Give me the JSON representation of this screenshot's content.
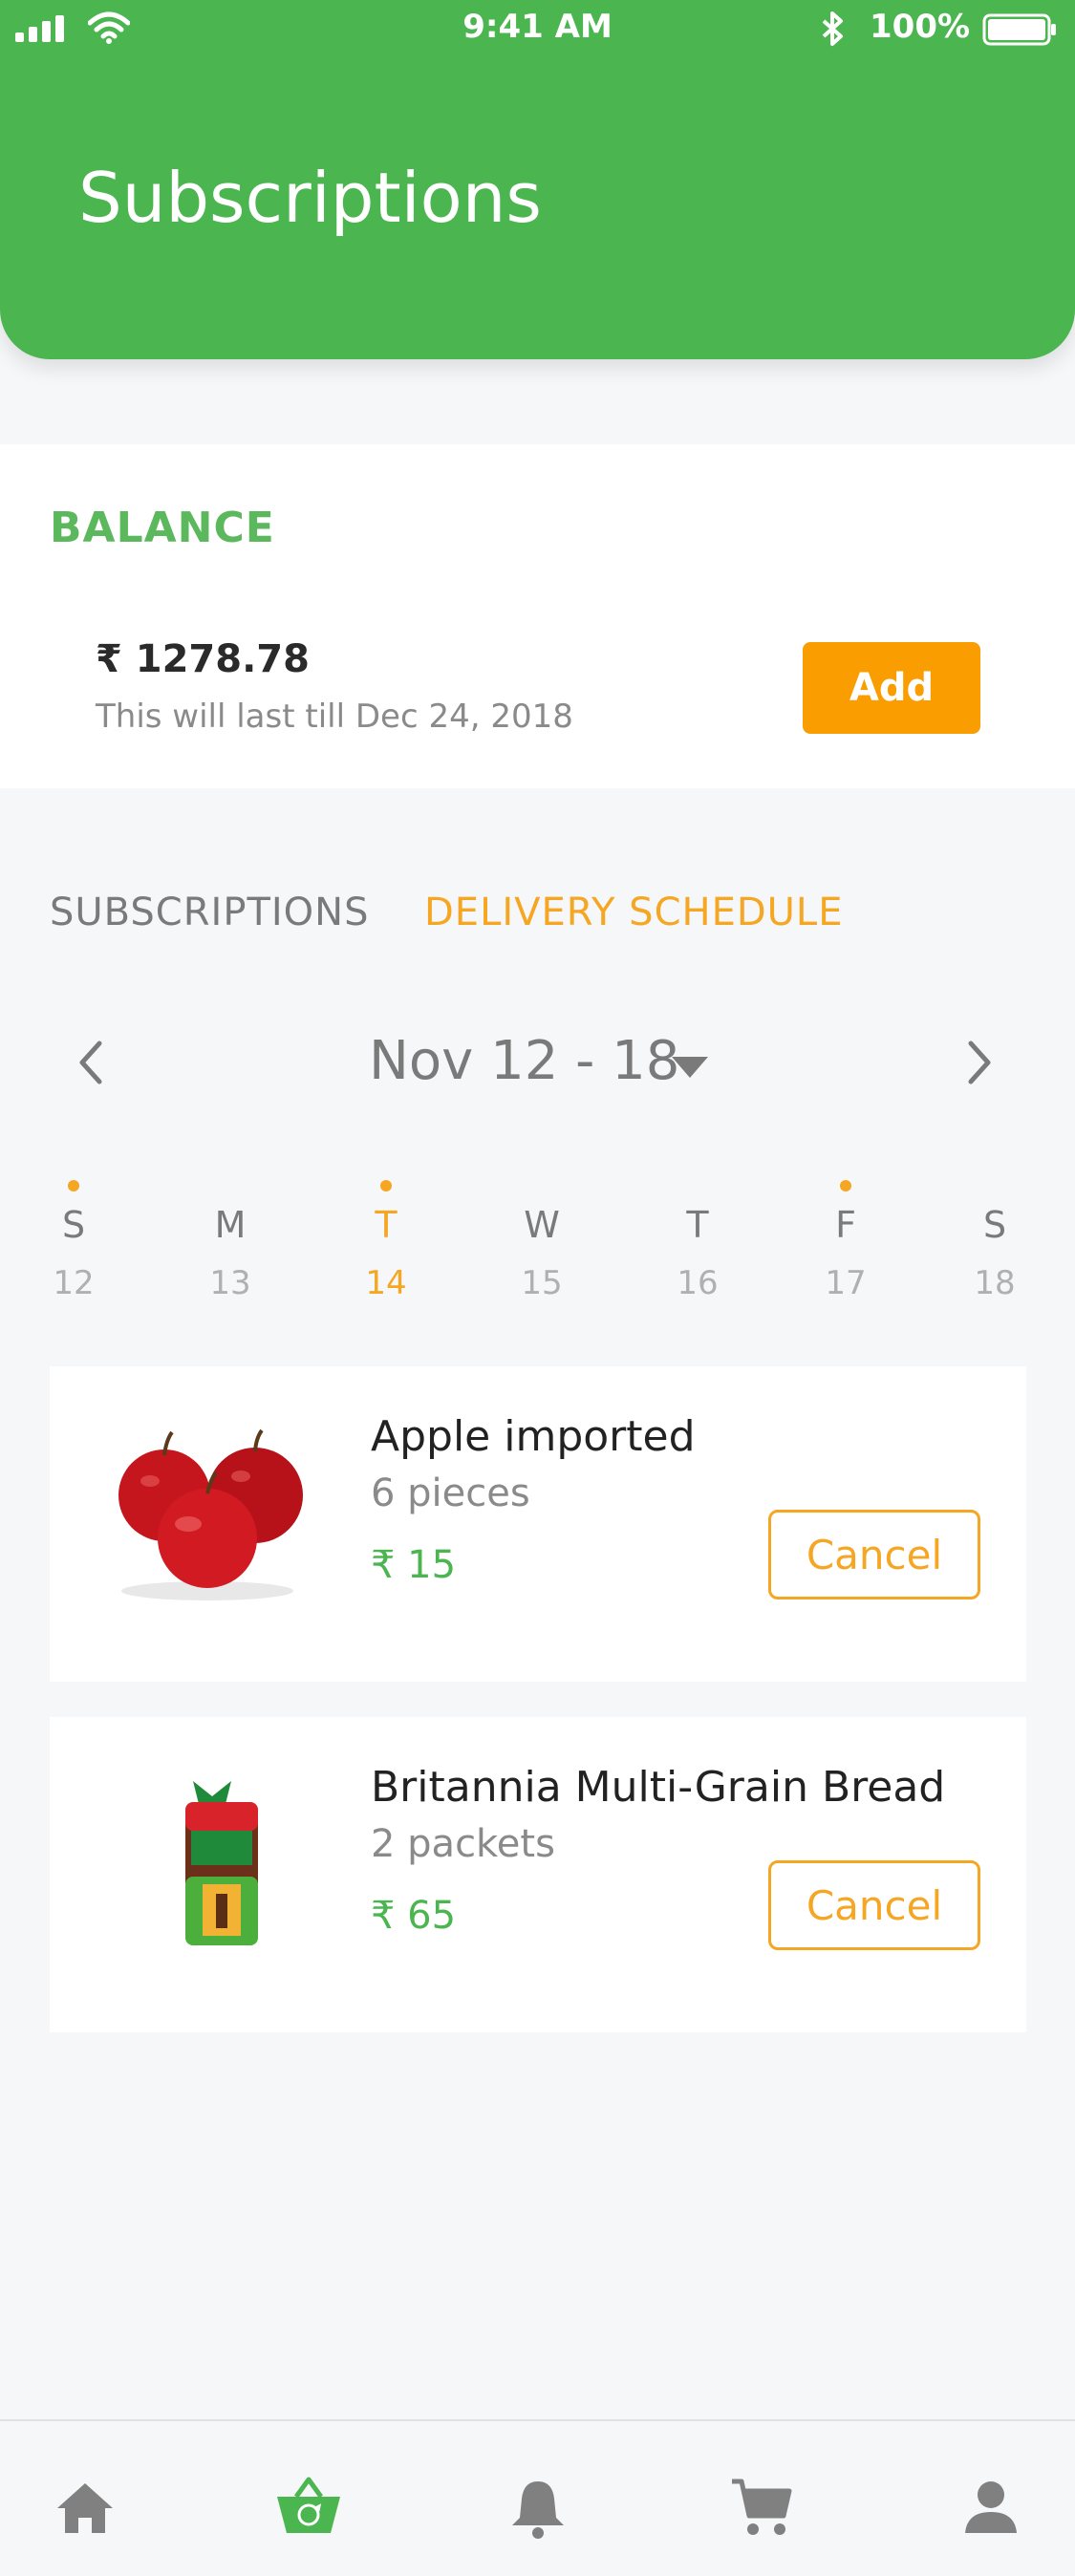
{
  "status_bar": {
    "time": "9:41 AM",
    "battery": "100%"
  },
  "header": {
    "title": "Subscriptions"
  },
  "balance": {
    "label": "BALANCE",
    "amount": "₹ 1278.78",
    "note": "This will last till Dec 24, 2018",
    "add_label": "Add"
  },
  "tabs": [
    {
      "label": "SUBSCRIPTIONS",
      "active": false
    },
    {
      "label": "DELIVERY SCHEDULE",
      "active": true
    }
  ],
  "week": {
    "range": "Nov 12 - 18",
    "days": [
      {
        "letter": "S",
        "num": "12",
        "dot": true,
        "active": false
      },
      {
        "letter": "M",
        "num": "13",
        "dot": false,
        "active": false
      },
      {
        "letter": "T",
        "num": "14",
        "dot": true,
        "active": true
      },
      {
        "letter": "W",
        "num": "15",
        "dot": false,
        "active": false
      },
      {
        "letter": "T",
        "num": "16",
        "dot": false,
        "active": false
      },
      {
        "letter": "F",
        "num": "17",
        "dot": true,
        "active": false
      },
      {
        "letter": "S",
        "num": "18",
        "dot": false,
        "active": false
      }
    ]
  },
  "items": [
    {
      "name": "Apple imported",
      "qty": "6 pieces",
      "price": "₹ 15",
      "cancel_label": "Cancel"
    },
    {
      "name": "Britannia Multi-Grain Bread",
      "qty": "2 packets",
      "price": "₹ 65",
      "cancel_label": "Cancel"
    }
  ],
  "colors": {
    "primary": "#4bb54f",
    "accent": "#f5a623",
    "background": "#f6f7f9"
  },
  "nav": [
    {
      "icon": "home-icon"
    },
    {
      "icon": "subscription-basket-icon",
      "active": true
    },
    {
      "icon": "bell-icon"
    },
    {
      "icon": "cart-icon"
    },
    {
      "icon": "user-icon"
    }
  ]
}
